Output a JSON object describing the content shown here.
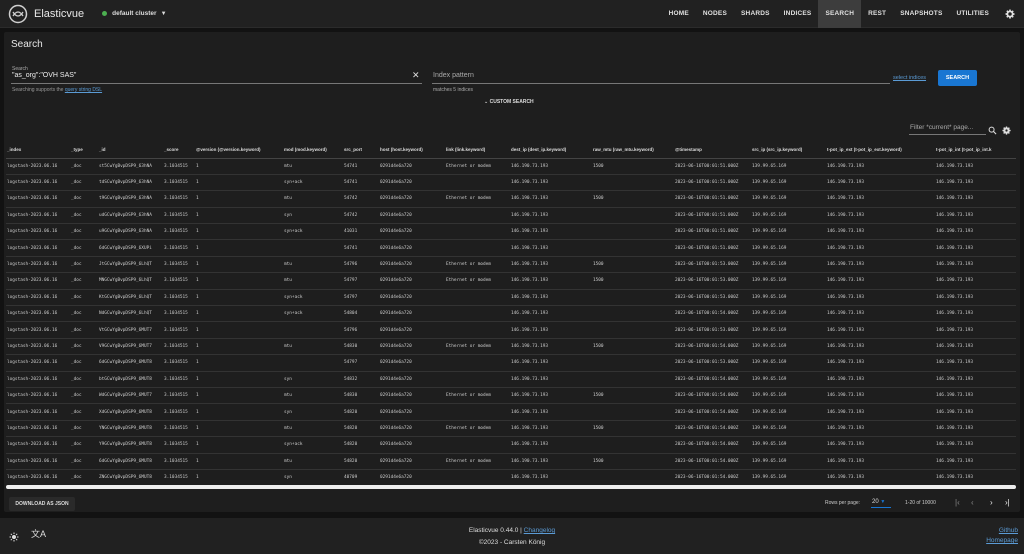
{
  "app": {
    "title": "Elasticvue",
    "cluster": "default cluster",
    "status_color": "#4caf50"
  },
  "nav": [
    "HOME",
    "NODES",
    "SHARDS",
    "INDICES",
    "SEARCH",
    "REST",
    "SNAPSHOTS",
    "UTILITIES"
  ],
  "page": {
    "title": "Search"
  },
  "search": {
    "label": "Search",
    "value": "\"as_org\":\"OVH SAS\"",
    "hint_prefix": "Searching supports the ",
    "hint_link": "query string DSL",
    "index_placeholder": "Index pattern",
    "matches": "matches 5 indices",
    "select_indices": "select indices",
    "button": "SEARCH",
    "custom": "CUSTOM SEARCH",
    "filter_placeholder": "Filter *current* page..."
  },
  "table": {
    "columns": [
      "_index",
      "_type",
      "_id",
      "_score",
      "@version (@version.keyword)",
      "mod (mod.keyword)",
      "src_port",
      "host (host.keyword)",
      "link (link.keyword)",
      "dest_ip (dest_ip.keyword)",
      "raw_mtu (raw_mtu.keyword)",
      "@timestamp",
      "src_ip (src_ip.keyword)",
      "t-pot_ip_ext (t-pot_ip_ext.keyword)",
      "t-pot_ip_int (t-pot_ip_int.k"
    ],
    "rows": [
      [
        "logstash-2023.06.16",
        "_doc",
        "st5CwYgBvpDSP9_63hNA",
        "3.1034515",
        "1",
        "mtu",
        "54741",
        "0291d4e6a720",
        "Ethernet or modem",
        "146.190.73.193",
        "1500",
        "2023-06-16T00:01:51.000Z",
        "139.99.65.169",
        "146.190.73.193",
        "146.190.73.193"
      ],
      [
        "logstash-2023.06.16",
        "_doc",
        "tdSCwYgBvpDSP9_63hNA",
        "3.1034515",
        "1",
        "syn+ack",
        "54741",
        "0291d4e6a720",
        "",
        "146.190.73.193",
        "",
        "2023-06-16T00:01:51.000Z",
        "139.99.65.169",
        "146.190.73.193",
        "146.190.73.193"
      ],
      [
        "logstash-2023.06.16",
        "_doc",
        "t9GCwYgBvpDSP9_63hNA",
        "3.1034515",
        "1",
        "mtu",
        "54742",
        "0291d4e6a720",
        "Ethernet or modem",
        "146.190.73.193",
        "1500",
        "2023-06-16T00:01:51.000Z",
        "139.99.65.169",
        "146.190.73.193",
        "146.190.73.193"
      ],
      [
        "logstash-2023.06.16",
        "_doc",
        "udGCwYgBvpDSP9_63hNA",
        "3.1034515",
        "1",
        "syn",
        "54742",
        "0291d4e6a720",
        "",
        "146.190.73.193",
        "",
        "2023-06-16T00:01:51.000Z",
        "139.99.65.169",
        "146.190.73.193",
        "146.190.73.193"
      ],
      [
        "logstash-2023.06.16",
        "_doc",
        "u9GCwYgBvpDSP9_63hNA",
        "3.1034515",
        "1",
        "syn+ack",
        "41031",
        "0291d4e6a720",
        "",
        "146.190.73.193",
        "",
        "2023-06-16T00:01:51.000Z",
        "139.99.65.169",
        "146.190.73.193",
        "146.190.73.193"
      ],
      [
        "logstash-2023.06.16",
        "_doc",
        "6dGCwYgBvpDSP9_6XUPi",
        "3.1034515",
        "1",
        "",
        "54741",
        "0291d4e6a720",
        "",
        "146.190.73.193",
        "",
        "2023-06-16T00:01:51.000Z",
        "139.99.65.169",
        "146.190.73.193",
        "146.190.73.193"
      ],
      [
        "logstash-2023.06.16",
        "_doc",
        "JtGCwYgBvpDSP9_6LhQT",
        "3.1034515",
        "1",
        "mtu",
        "54796",
        "0291d4e6a720",
        "Ethernet or modem",
        "146.190.73.193",
        "1500",
        "2023-06-16T00:01:53.000Z",
        "139.99.65.169",
        "146.190.73.193",
        "146.190.73.193"
      ],
      [
        "logstash-2023.06.16",
        "_doc",
        "MNGCwYgBvpDSP9_6LhQT",
        "3.1034515",
        "1",
        "mtu",
        "54797",
        "0291d4e6a720",
        "Ethernet or modem",
        "146.190.73.193",
        "1500",
        "2023-06-16T00:01:53.000Z",
        "139.99.65.169",
        "146.190.73.193",
        "146.190.73.193"
      ],
      [
        "logstash-2023.06.16",
        "_doc",
        "KtGCwYgBvpDSP9_6LhQT",
        "3.1034515",
        "1",
        "syn+ack",
        "54797",
        "0291d4e6a720",
        "",
        "146.190.73.193",
        "",
        "2023-06-16T00:01:53.000Z",
        "139.99.65.169",
        "146.190.73.193",
        "146.190.73.193"
      ],
      [
        "logstash-2023.06.16",
        "_doc",
        "NdGCwYgBvpDSP9_6LhQT",
        "3.1034515",
        "1",
        "syn+ack",
        "54804",
        "0291d4e6a720",
        "",
        "146.190.73.193",
        "",
        "2023-06-16T00:01:54.000Z",
        "139.99.65.169",
        "146.190.73.193",
        "146.190.73.193"
      ],
      [
        "logstash-2023.06.16",
        "_doc",
        "VtGCwYgBvpDSP9_6MUT7",
        "3.1034515",
        "1",
        "",
        "54796",
        "0291d4e6a720",
        "",
        "146.190.73.193",
        "",
        "2023-06-16T00:01:53.000Z",
        "139.99.65.169",
        "146.190.73.193",
        "146.190.73.193"
      ],
      [
        "logstash-2023.06.16",
        "_doc",
        "V9GCwYgBvpDSP9_6MUT7",
        "3.1034515",
        "1",
        "mtu",
        "54830",
        "0291d4e6a720",
        "Ethernet or modem",
        "146.190.73.193",
        "1500",
        "2023-06-16T00:01:54.000Z",
        "139.99.65.169",
        "146.190.73.193",
        "146.190.73.193"
      ],
      [
        "logstash-2023.06.16",
        "_doc",
        "6dGCwYgBvpDSP9_6MUT8",
        "3.1034515",
        "1",
        "",
        "54797",
        "0291d4e6a720",
        "",
        "146.190.73.193",
        "",
        "2023-06-16T00:01:53.000Z",
        "139.99.65.169",
        "146.190.73.193",
        "146.190.73.193"
      ],
      [
        "logstash-2023.06.16",
        "_doc",
        "btGCwYgBvpDSP9_6MUT8",
        "3.1034515",
        "1",
        "syn",
        "54832",
        "0291d4e6a720",
        "",
        "146.190.73.193",
        "",
        "2023-06-16T00:01:54.000Z",
        "139.99.65.169",
        "146.190.73.193",
        "146.190.73.193"
      ],
      [
        "logstash-2023.06.16",
        "_doc",
        "WdGCwYgBvpDSP9_6MUT7",
        "3.1034515",
        "1",
        "mtu",
        "54830",
        "0291d4e6a720",
        "Ethernet or modem",
        "146.190.73.193",
        "1500",
        "2023-06-16T00:01:54.000Z",
        "139.99.65.169",
        "146.190.73.193",
        "146.190.73.193"
      ],
      [
        "logstash-2023.06.16",
        "_doc",
        "XdGCwYgBvpDSP9_6MUT8",
        "3.1034515",
        "1",
        "syn",
        "54820",
        "0291d4e6a720",
        "",
        "146.190.73.193",
        "",
        "2023-06-16T00:01:54.000Z",
        "139.99.65.169",
        "146.190.73.193",
        "146.190.73.193"
      ],
      [
        "logstash-2023.06.16",
        "_doc",
        "YNGCwYgBvpDSP9_6MUT8",
        "3.1034515",
        "1",
        "mtu",
        "54820",
        "0291d4e6a720",
        "Ethernet or modem",
        "146.190.73.193",
        "1500",
        "2023-06-16T00:01:54.000Z",
        "139.99.65.169",
        "146.190.73.193",
        "146.190.73.193"
      ],
      [
        "logstash-2023.06.16",
        "_doc",
        "Y9GCwYgBvpDSP9_6MUT8",
        "3.1034515",
        "1",
        "syn+ack",
        "54820",
        "0291d4e6a720",
        "",
        "146.190.73.193",
        "",
        "2023-06-16T00:01:54.000Z",
        "139.99.65.169",
        "146.190.73.193",
        "146.190.73.193"
      ],
      [
        "logstash-2023.06.16",
        "_doc",
        "6dGCwYgBvpDSP9_6MUT8",
        "3.1034515",
        "1",
        "mtu",
        "54820",
        "0291d4e6a720",
        "Ethernet or modem",
        "146.190.73.193",
        "1500",
        "2023-06-16T00:01:54.000Z",
        "139.99.65.169",
        "146.190.73.193",
        "146.190.73.193"
      ],
      [
        "logstash-2023.06.16",
        "_doc",
        "ZNGCwYgBvpDSP9_6MUT8",
        "3.1034515",
        "1",
        "syn",
        "40709",
        "0291d4e6a720",
        "",
        "146.190.73.193",
        "",
        "2023-06-16T00:01:54.000Z",
        "139.99.65.169",
        "146.190.73.193",
        "146.190.73.193"
      ]
    ]
  },
  "footer_bar": {
    "download": "DOWNLOAD AS JSON",
    "rows_per_page_label": "Rows per page:",
    "rows_per_page": "20",
    "range": "1-20 of 10000"
  },
  "footer": {
    "version": "Elasticvue 0.44.0 |",
    "changelog": "Changelog",
    "copyright": "©2023 - Carsten König",
    "github": "Github",
    "homepage": "Homepage"
  }
}
